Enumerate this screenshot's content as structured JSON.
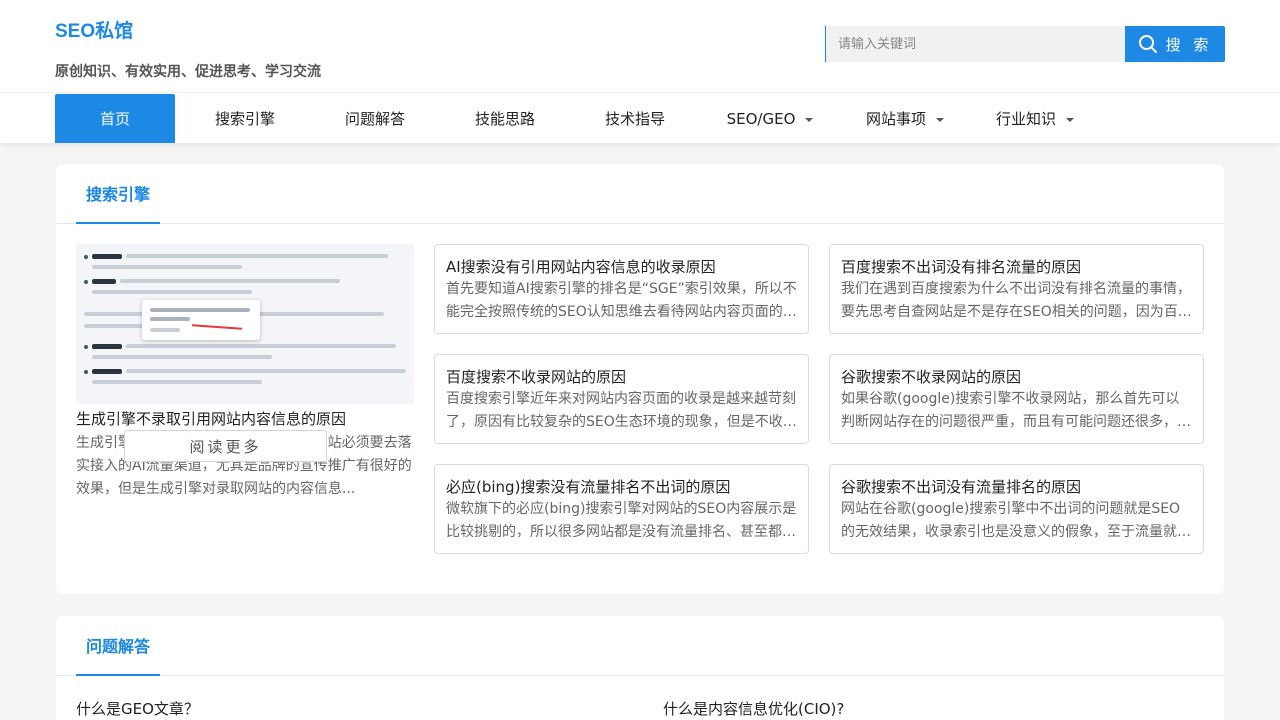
{
  "site": {
    "logo": "SEO私馆",
    "tagline": "原创知识、有效实用、促进思考、学习交流"
  },
  "search": {
    "placeholder": "请输入关键词",
    "button_label": "搜 索",
    "icon": "search-icon"
  },
  "nav": {
    "items": [
      {
        "label": "首页",
        "active": true,
        "dropdown": false
      },
      {
        "label": "搜索引擎",
        "active": false,
        "dropdown": false
      },
      {
        "label": "问题解答",
        "active": false,
        "dropdown": false
      },
      {
        "label": "技能思路",
        "active": false,
        "dropdown": false
      },
      {
        "label": "技术指导",
        "active": false,
        "dropdown": false
      },
      {
        "label": "SEO/GEO",
        "active": false,
        "dropdown": true
      },
      {
        "label": "网站事项",
        "active": false,
        "dropdown": true
      },
      {
        "label": "行业知识",
        "active": false,
        "dropdown": true
      }
    ]
  },
  "colors": {
    "accent": "#1e88e5",
    "page_bg": "#f4f4f4"
  },
  "section_search": {
    "title": "搜索引擎",
    "feature": {
      "title": "生成引擎不录取引用网站内容信息的原因",
      "desc": "生成引擎优化(GEO)已经是现在大多数网站必须要去落实接入的AI流量渠道，尤其是品牌的宣传推广有很好的效果，但是生成引擎对录取网站的内容信息...",
      "read_more": "阅读更多"
    },
    "cards": [
      {
        "title": "AI搜索没有引用网站内容信息的收录原因",
        "desc": "首先要知道AI搜索引擎的排名是“SGE”索引效果，所以不能完全按照传统的SEO认知思维去看待网站内容页面的收录"
      },
      {
        "title": "百度搜索不出词没有排名流量的原因",
        "desc": "我们在遇到百度搜索为什么不出词没有排名流量的事情，要先思考自查网站是不是存在SEO相关的问题，因为百度搜索"
      },
      {
        "title": "百度搜索不收录网站的原因",
        "desc": "百度搜索引擎近年来对网站内容页面的收录是越来越苛刻了，原因有比较复杂的SEO生态环境的现象，但是不收录的"
      },
      {
        "title": "谷歌搜索不收录网站的原因",
        "desc": "如果谷歌(google)搜索引擎不收录网站，那么首先可以判断网站存在的问题很严重，而且有可能问题还很多，因为谷歌"
      },
      {
        "title": "必应(bing)搜索没有流量排名不出词的原因",
        "desc": "微软旗下的必应(bing)搜索引擎对网站的SEO内容展示是比较挑剔的，所以很多网站都是没有流量排名、甚至都不出词"
      },
      {
        "title": "谷歌搜索不出词没有流量排名的原因",
        "desc": "网站在谷歌(google)搜索引擎中不出词的问题就是SEO的无效结果，收录索引也是没意义的假象，至于流量就涉及到"
      }
    ]
  },
  "section_qa": {
    "title": "问题解答",
    "items": [
      {
        "title": "什么是GEO文章？"
      },
      {
        "title": "什么是内容信息优化(CIO)?"
      }
    ]
  }
}
